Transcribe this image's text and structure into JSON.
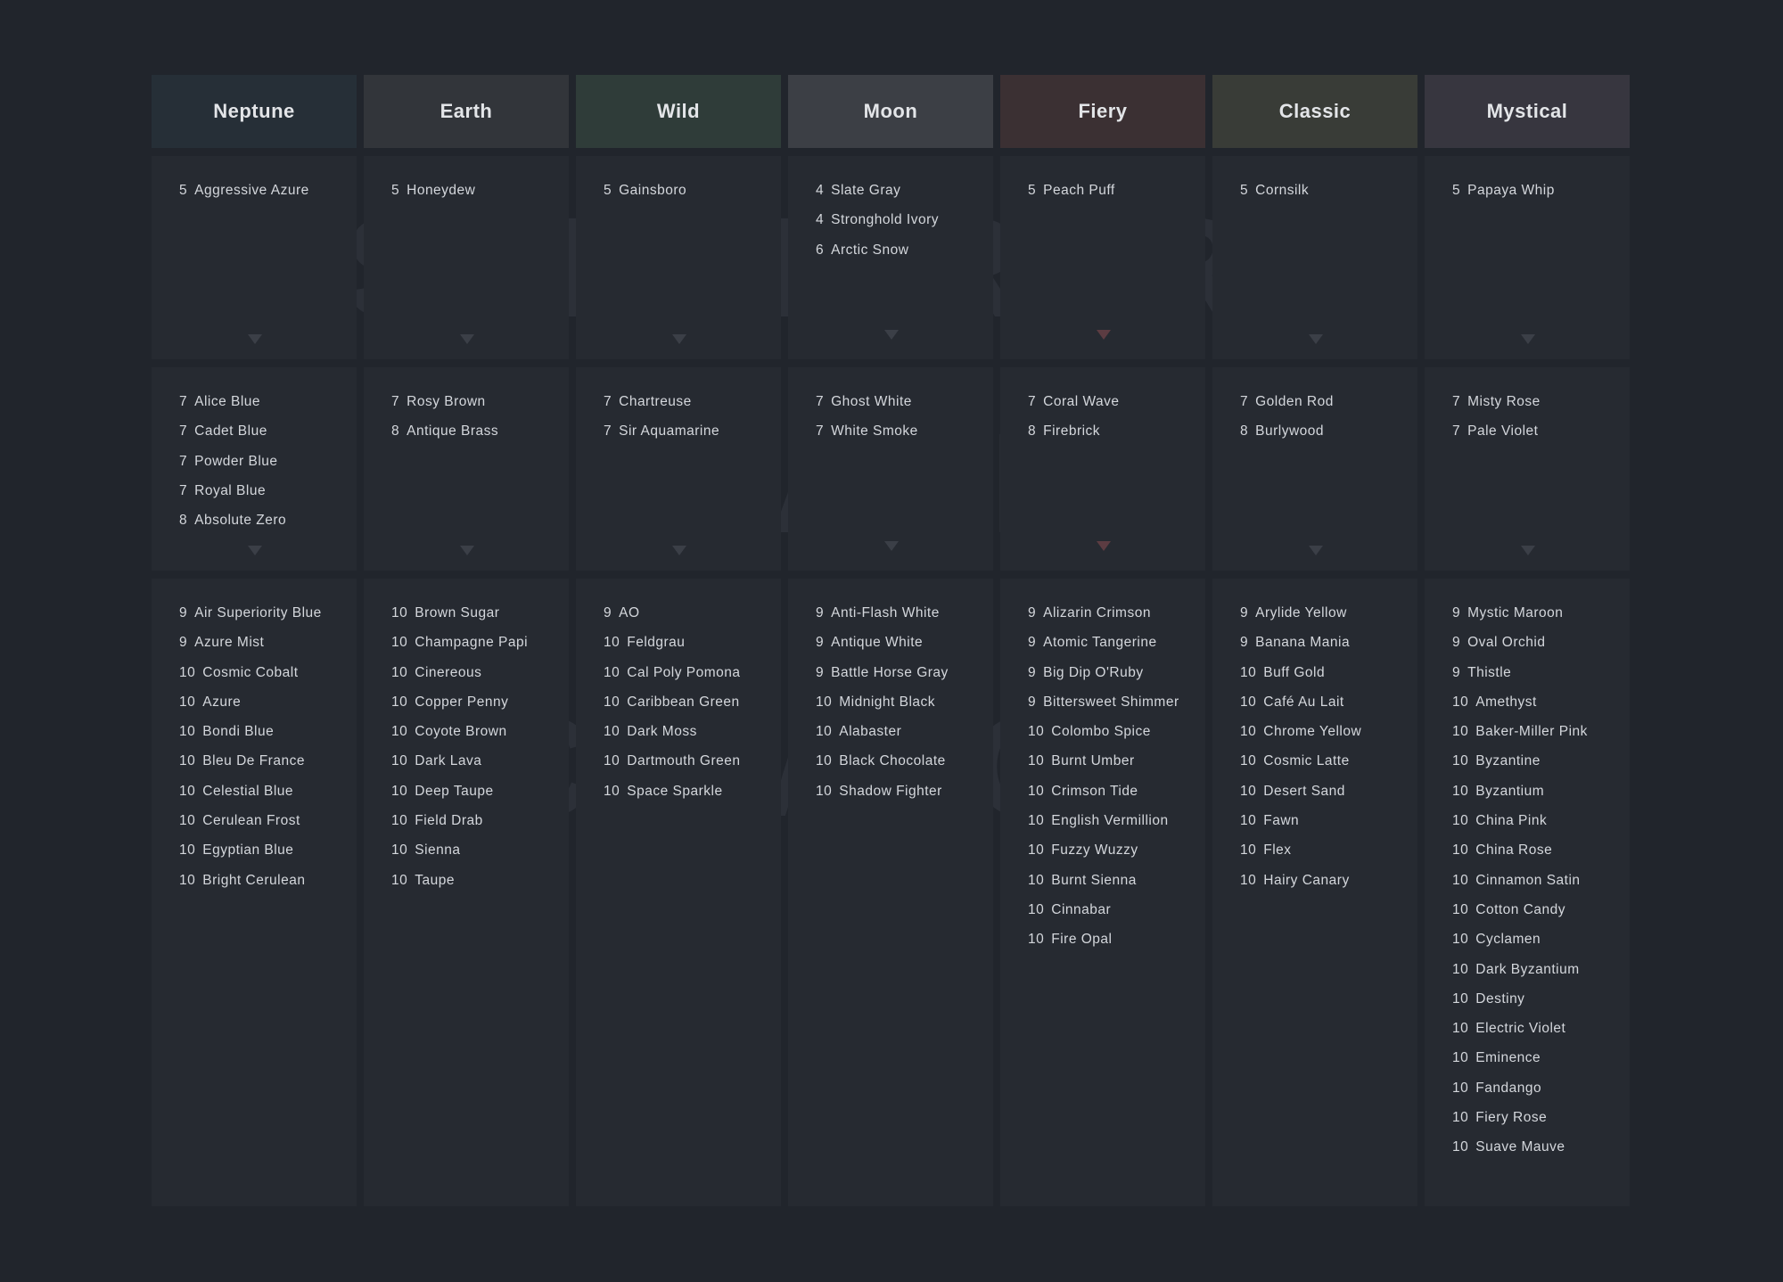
{
  "watermarks": {
    "super_rare": "SUPER RARE",
    "rare": "RARE",
    "common": "COMMON"
  },
  "colors": {
    "background": "#21252c",
    "panel": "#262a31",
    "text": "#d4d7dc",
    "arrow": "#3b3f47",
    "arrow_fiery": "#5c3c42"
  },
  "columns": [
    {
      "name": "Neptune",
      "header_color": "#262f37",
      "super_rare": [
        {
          "count": "5",
          "name": "Aggressive Azure"
        }
      ],
      "rare": [
        {
          "count": "7",
          "name": "Alice Blue"
        },
        {
          "count": "7",
          "name": "Cadet Blue"
        },
        {
          "count": "7",
          "name": "Powder Blue"
        },
        {
          "count": "7",
          "name": "Royal Blue"
        },
        {
          "count": "8",
          "name": "Absolute Zero"
        }
      ],
      "common": [
        {
          "count": "9",
          "name": "Air Superiority Blue"
        },
        {
          "count": "9",
          "name": "Azure Mist"
        },
        {
          "count": "10",
          "name": "Cosmic Cobalt"
        },
        {
          "count": "10",
          "name": "Azure"
        },
        {
          "count": "10",
          "name": "Bondi Blue"
        },
        {
          "count": "10",
          "name": "Bleu De France"
        },
        {
          "count": "10",
          "name": "Celestial Blue"
        },
        {
          "count": "10",
          "name": "Cerulean Frost"
        },
        {
          "count": "10",
          "name": "Egyptian Blue"
        },
        {
          "count": "10",
          "name": "Bright Cerulean"
        }
      ]
    },
    {
      "name": "Earth",
      "header_color": "#32353a",
      "super_rare": [
        {
          "count": "5",
          "name": "Honeydew"
        }
      ],
      "rare": [
        {
          "count": "7",
          "name": "Rosy Brown"
        },
        {
          "count": "8",
          "name": "Antique Brass"
        }
      ],
      "common": [
        {
          "count": "10",
          "name": "Brown Sugar"
        },
        {
          "count": "10",
          "name": "Champagne Papi"
        },
        {
          "count": "10",
          "name": "Cinereous"
        },
        {
          "count": "10",
          "name": "Copper Penny"
        },
        {
          "count": "10",
          "name": "Coyote Brown"
        },
        {
          "count": "10",
          "name": "Dark Lava"
        },
        {
          "count": "10",
          "name": "Deep Taupe"
        },
        {
          "count": "10",
          "name": "Field Drab"
        },
        {
          "count": "10",
          "name": "Sienna"
        },
        {
          "count": "10",
          "name": "Taupe"
        }
      ]
    },
    {
      "name": "Wild",
      "header_color": "#2f3c39",
      "super_rare": [
        {
          "count": "5",
          "name": "Gainsboro"
        }
      ],
      "rare": [
        {
          "count": "7",
          "name": "Chartreuse"
        },
        {
          "count": "7",
          "name": "Sir Aquamarine"
        }
      ],
      "common": [
        {
          "count": "9",
          "name": "AO"
        },
        {
          "count": "10",
          "name": "Feldgrau"
        },
        {
          "count": "10",
          "name": "Cal Poly Pomona"
        },
        {
          "count": "10",
          "name": "Caribbean Green"
        },
        {
          "count": "10",
          "name": "Dark Moss"
        },
        {
          "count": "10",
          "name": "Dartmouth Green"
        },
        {
          "count": "10",
          "name": "Space Sparkle"
        }
      ]
    },
    {
      "name": "Moon",
      "header_color": "#3c3f45",
      "super_rare": [
        {
          "count": "4",
          "name": "Slate Gray"
        },
        {
          "count": "4",
          "name": "Stronghold Ivory"
        },
        {
          "count": "6",
          "name": "Arctic Snow"
        }
      ],
      "rare": [
        {
          "count": "7",
          "name": "Ghost White"
        },
        {
          "count": "7",
          "name": "White Smoke"
        }
      ],
      "common": [
        {
          "count": "9",
          "name": "Anti-Flash White"
        },
        {
          "count": "9",
          "name": "Antique White"
        },
        {
          "count": "9",
          "name": "Battle Horse Gray"
        },
        {
          "count": "10",
          "name": "Midnight Black"
        },
        {
          "count": "10",
          "name": "Alabaster"
        },
        {
          "count": "10",
          "name": "Black Chocolate"
        },
        {
          "count": "10",
          "name": "Shadow Fighter"
        }
      ]
    },
    {
      "name": "Fiery",
      "header_color": "#3b3033",
      "super_rare": [
        {
          "count": "5",
          "name": "Peach Puff"
        }
      ],
      "rare": [
        {
          "count": "7",
          "name": "Coral Wave"
        },
        {
          "count": "8",
          "name": "Firebrick"
        }
      ],
      "common": [
        {
          "count": "9",
          "name": "Alizarin Crimson"
        },
        {
          "count": "9",
          "name": "Atomic Tangerine"
        },
        {
          "count": "9",
          "name": "Big Dip O'Ruby"
        },
        {
          "count": "9",
          "name": "Bittersweet Shimmer"
        },
        {
          "count": "10",
          "name": "Colombo Spice"
        },
        {
          "count": "10",
          "name": "Burnt Umber"
        },
        {
          "count": "10",
          "name": "Crimson Tide"
        },
        {
          "count": "10",
          "name": "English Vermillion"
        },
        {
          "count": "10",
          "name": "Fuzzy Wuzzy"
        },
        {
          "count": "10",
          "name": "Burnt Sienna"
        },
        {
          "count": "10",
          "name": "Cinnabar"
        },
        {
          "count": "10",
          "name": "Fire Opal"
        }
      ]
    },
    {
      "name": "Classic",
      "header_color": "#393c37",
      "super_rare": [
        {
          "count": "5",
          "name": "Cornsilk"
        }
      ],
      "rare": [
        {
          "count": "7",
          "name": "Golden Rod"
        },
        {
          "count": "8",
          "name": "Burlywood"
        }
      ],
      "common": [
        {
          "count": "9",
          "name": "Arylide Yellow"
        },
        {
          "count": "9",
          "name": "Banana Mania"
        },
        {
          "count": "10",
          "name": "Buff Gold"
        },
        {
          "count": "10",
          "name": "Café Au Lait"
        },
        {
          "count": "10",
          "name": "Chrome Yellow"
        },
        {
          "count": "10",
          "name": "Cosmic Latte"
        },
        {
          "count": "10",
          "name": "Desert Sand"
        },
        {
          "count": "10",
          "name": "Fawn"
        },
        {
          "count": "10",
          "name": "Flex"
        },
        {
          "count": "10",
          "name": "Hairy Canary"
        }
      ]
    },
    {
      "name": "Mystical",
      "header_color": "#37363f",
      "super_rare": [
        {
          "count": "5",
          "name": "Papaya Whip"
        }
      ],
      "rare": [
        {
          "count": "7",
          "name": "Misty Rose"
        },
        {
          "count": "7",
          "name": "Pale Violet"
        }
      ],
      "common": [
        {
          "count": "9",
          "name": "Mystic Maroon"
        },
        {
          "count": "9",
          "name": "Oval Orchid"
        },
        {
          "count": "9",
          "name": "Thistle"
        },
        {
          "count": "10",
          "name": "Amethyst"
        },
        {
          "count": "10",
          "name": "Baker-Miller Pink"
        },
        {
          "count": "10",
          "name": "Byzantine"
        },
        {
          "count": "10",
          "name": "Byzantium"
        },
        {
          "count": "10",
          "name": "China Pink"
        },
        {
          "count": "10",
          "name": "China Rose"
        },
        {
          "count": "10",
          "name": "Cinnamon Satin"
        },
        {
          "count": "10",
          "name": "Cotton Candy"
        },
        {
          "count": "10",
          "name": "Cyclamen"
        },
        {
          "count": "10",
          "name": "Dark Byzantium"
        },
        {
          "count": "10",
          "name": "Destiny"
        },
        {
          "count": "10",
          "name": "Electric Violet"
        },
        {
          "count": "10",
          "name": "Eminence"
        },
        {
          "count": "10",
          "name": "Fandango"
        },
        {
          "count": "10",
          "name": "Fiery Rose"
        },
        {
          "count": "10",
          "name": "Suave Mauve"
        }
      ]
    }
  ]
}
